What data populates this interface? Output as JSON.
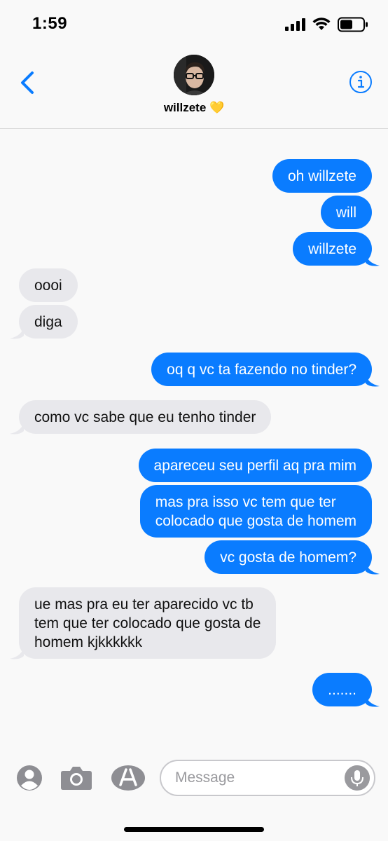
{
  "status_bar": {
    "time": "1:59"
  },
  "header": {
    "contact_name": "willzete 💛"
  },
  "messages": [
    {
      "from": "me",
      "text": "oh willzete"
    },
    {
      "from": "me",
      "text": "will"
    },
    {
      "from": "me",
      "text": "willzete"
    },
    {
      "from": "them",
      "text": "oooi"
    },
    {
      "from": "them",
      "text": "diga"
    },
    {
      "from": "me",
      "text": "oq q vc ta fazendo no tinder?"
    },
    {
      "from": "them",
      "text": "como vc sabe que eu tenho tinder"
    },
    {
      "from": "me",
      "text": "apareceu seu perfil aq pra mim"
    },
    {
      "from": "me",
      "text": "mas pra isso vc tem que ter\ncolocado que gosta de homem"
    },
    {
      "from": "me",
      "text": "vc gosta de homem?"
    },
    {
      "from": "them",
      "text": "ue mas pra eu ter aparecido vc tb\ntem que ter colocado que gosta de\nhomem kjkkkkkk"
    },
    {
      "from": "me",
      "text": "......."
    }
  ],
  "composer": {
    "placeholder": "Message"
  },
  "colors": {
    "outgoing": "#0a7cff",
    "incoming": "#e8e8ec",
    "accent": "#0a7cff"
  },
  "icons": [
    "back-chevron-icon",
    "info-icon",
    "contact-icon",
    "camera-icon",
    "app-store-icon",
    "microphone-icon"
  ]
}
